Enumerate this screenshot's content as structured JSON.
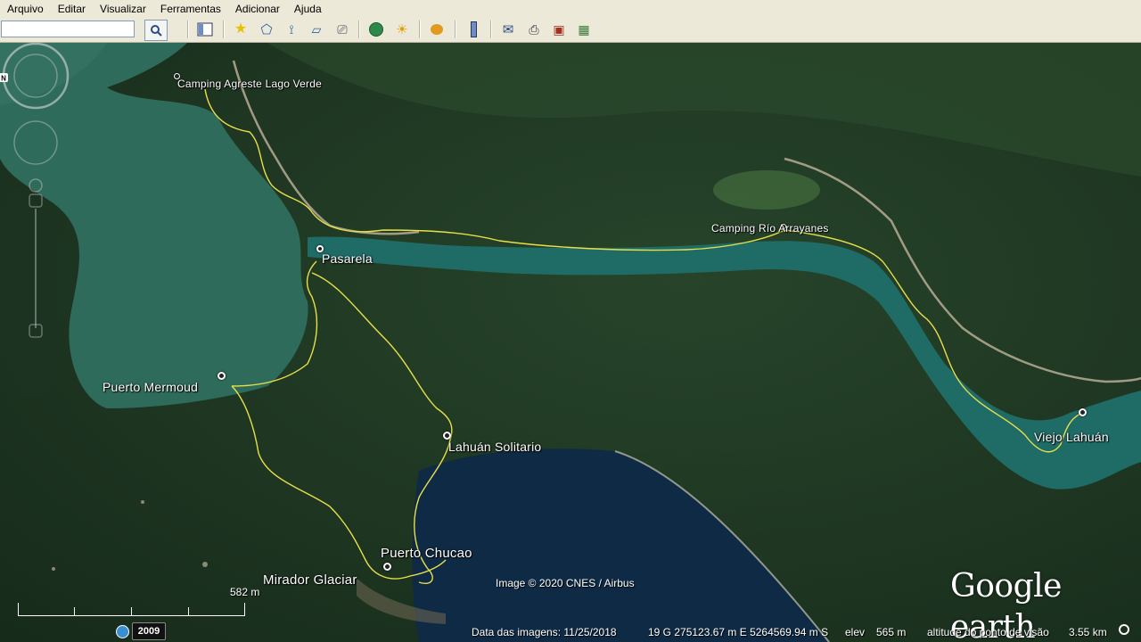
{
  "menu": [
    "Arquivo",
    "Editar",
    "Visualizar",
    "Ferramentas",
    "Adicionar",
    "Ajuda"
  ],
  "search": {
    "value": "",
    "placeholder": ""
  },
  "places": {
    "camping_agreste": "Camping Agreste Lago Verde",
    "camping_rio": "Camping Río Arrayanes",
    "pasarela": "Pasarela",
    "puerto_mermoud": "Puerto Mermoud",
    "lahuan_solitario": "Lahuán Solitario",
    "viejo_lahuan": "Viejo Lahuán",
    "puerto_chucao": "Puerto Chucao",
    "mirador_glaciar": "Mirador Glaciar"
  },
  "copyright": "Image © 2020 CNES / Airbus",
  "logo": {
    "brand": "Google",
    "product": "earth"
  },
  "scale": {
    "label": "582 m"
  },
  "status": {
    "year": "2009",
    "image_date": "Data das imagens: 11/25/2018",
    "coords": "19 G 275123.67 m E 5264569.94 m S",
    "elev_label": "elev",
    "elev_value": "565 m",
    "eye_alt_label": "altitude do ponto de visão",
    "eye_alt_value": "3.55 km"
  },
  "colors": {
    "track": "#e8e04a",
    "water_lake": "#2d6a58",
    "water_river": "#1f6a66",
    "forest": "#1e3a1f",
    "chrome": "#ece9d8"
  },
  "icons": [
    "search-icon",
    "sidebar-icon",
    "placemark-icon",
    "polygon-icon",
    "path-icon",
    "overlay-icon",
    "tour-icon",
    "historical-imagery-icon",
    "sunlight-icon",
    "planet-icon",
    "ruler-icon",
    "email-icon",
    "print-icon",
    "save-image-icon",
    "maps-icon"
  ]
}
